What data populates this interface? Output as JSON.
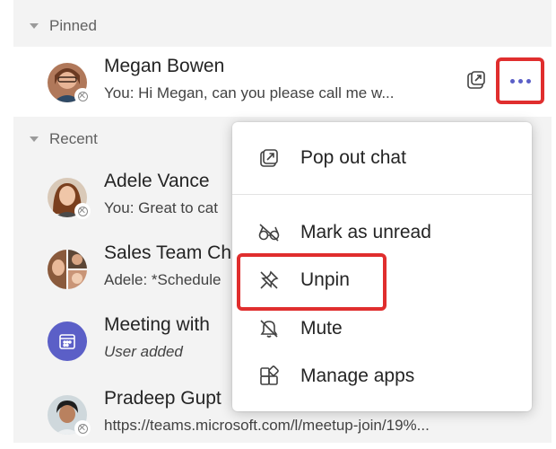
{
  "sections": {
    "pinned": "Pinned",
    "recent": "Recent"
  },
  "chats": [
    {
      "name": "Megan Bowen",
      "preview": "You: Hi Megan, can you please call me w...",
      "pinned": true
    },
    {
      "name": "Adele Vance",
      "preview": "You: Great to cat"
    },
    {
      "name": "Sales Team Ch",
      "preview": "Adele: *Schedule"
    },
    {
      "name": "Meeting with",
      "preview": "User added"
    },
    {
      "name": "Pradeep Gupt",
      "preview": "https://teams.microsoft.com/l/meetup-join/19%..."
    }
  ],
  "icons": {
    "popout": "popout-icon",
    "more": "more-options-icon",
    "meeting": "calendar-icon"
  },
  "menu": {
    "items": [
      {
        "label": "Pop out chat",
        "icon": "popout-icon"
      },
      {
        "label": "Mark as unread",
        "icon": "glasses-icon"
      },
      {
        "label": "Unpin",
        "icon": "unpin-icon"
      },
      {
        "label": "Mute",
        "icon": "bell-off-icon"
      },
      {
        "label": "Manage apps",
        "icon": "apps-icon"
      }
    ]
  },
  "colors": {
    "accent": "#5b5fc7",
    "highlight": "#e02e2e",
    "panel_bg": "#f3f3f3"
  }
}
